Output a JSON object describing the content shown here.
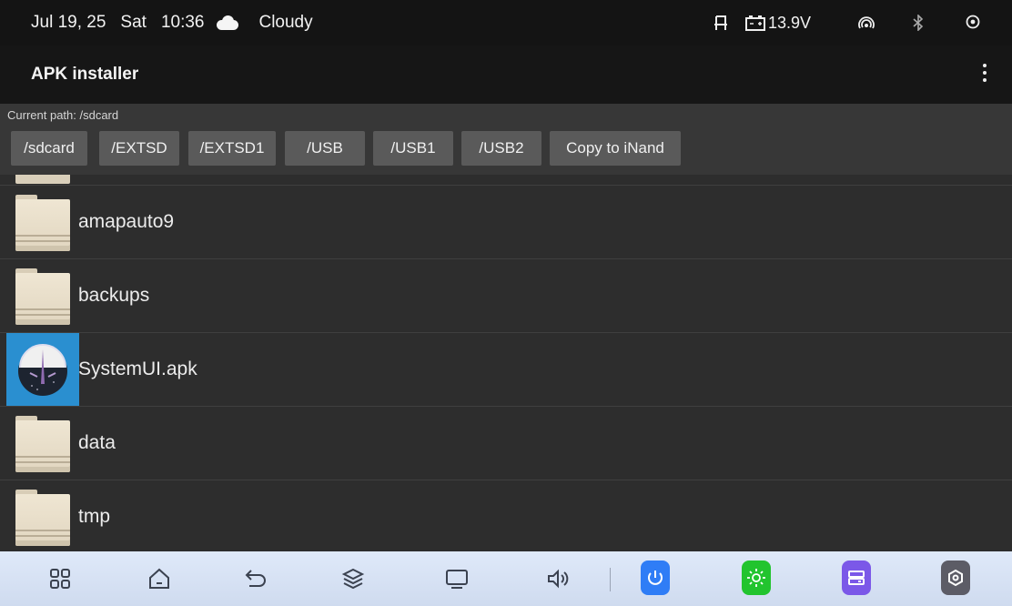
{
  "status": {
    "date": "Jul 19, 25",
    "day": "Sat",
    "time": "10:36",
    "weather": "Cloudy",
    "voltage": "13.9V"
  },
  "appbar": {
    "title": "APK installer"
  },
  "path": {
    "label": "Current path: /sdcard",
    "buttons": [
      "/sdcard",
      "/EXTSD",
      "/EXTSD1",
      "/USB",
      "/USB1",
      "/USB2",
      "Copy to iNand"
    ]
  },
  "files": [
    {
      "name": "amapauto9",
      "icon": "folder-icon"
    },
    {
      "name": "backups",
      "icon": "folder-icon"
    },
    {
      "name": "SystemUI.apk",
      "icon": "apk-icon"
    },
    {
      "name": "data",
      "icon": "folder-icon"
    },
    {
      "name": "tmp",
      "icon": "folder-icon"
    }
  ],
  "navbar": {
    "icons": [
      "apps-grid-icon",
      "home-icon",
      "back-icon",
      "layers-icon",
      "screen-icon",
      "volume-icon",
      "power-icon",
      "brightness-icon",
      "storage-icon",
      "settings-icon"
    ],
    "colors": {
      "power": "#2f7df6",
      "brightness": "#22c42e",
      "storage": "#7b58e8",
      "settings": "#5c5c66"
    }
  }
}
